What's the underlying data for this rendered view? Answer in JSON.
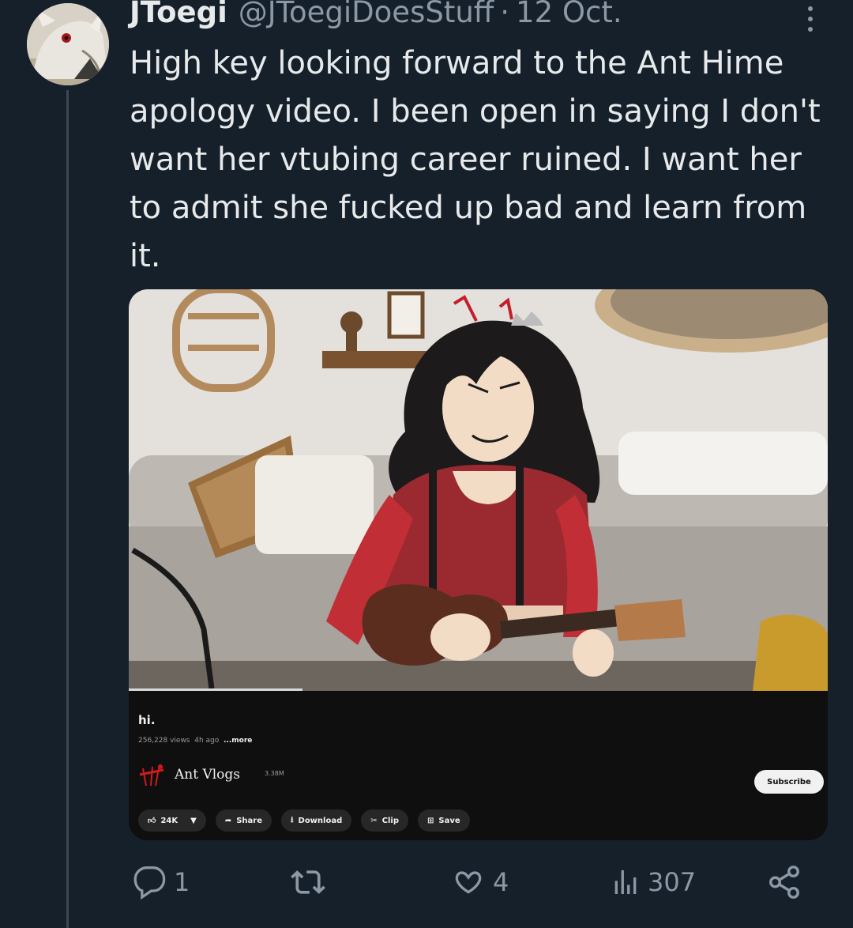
{
  "tweet": {
    "display_name": "JToegi",
    "handle": "@JToegiDoesStuff",
    "separator": "·",
    "date": "12 Oct.",
    "text": "High key looking forward to the Ant Hime apology video. I been open in saying I don't want her vtubing career ruined. I want her to admit she fucked up bad and learn from it."
  },
  "embedded_video": {
    "title": "hi.",
    "views": "256,228 views",
    "age": "4h ago",
    "more": "...more",
    "channel_name": "Ant Vlogs",
    "subscriber_count": "3.38M",
    "subscribe_label": "Subscribe",
    "likes": "24K",
    "share_label": "Share",
    "download_label": "Download",
    "clip_label": "Clip",
    "save_label": "Save"
  },
  "actions": {
    "replies": "1",
    "reposts": "",
    "likes": "4",
    "views": "307"
  },
  "colors": {
    "background": "#15202b",
    "text_primary": "#e7e9ea",
    "text_secondary": "#8b98a5"
  }
}
